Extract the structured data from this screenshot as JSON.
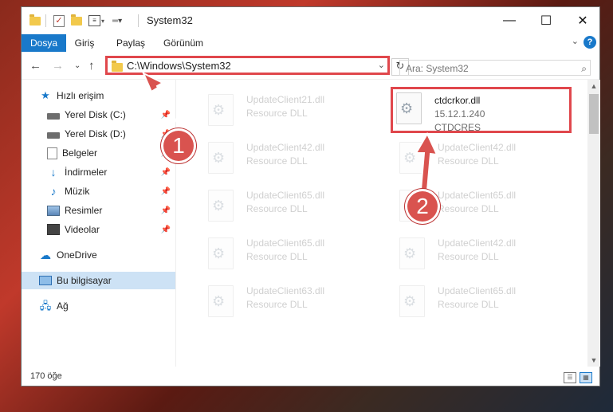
{
  "window": {
    "title": "System32"
  },
  "ribbon": {
    "tabs": [
      {
        "label": "Dosya",
        "active": true
      },
      {
        "label": "Giriş"
      },
      {
        "label": "Paylaş"
      },
      {
        "label": "Görünüm"
      }
    ],
    "help": "?"
  },
  "address": {
    "path": "C:\\Windows\\System32",
    "search_placeholder": "Ara: System32"
  },
  "nav": {
    "items": [
      {
        "label": "Hızlı erişim",
        "icon": "star-icon"
      },
      {
        "label": "Yerel Disk (C:)",
        "icon": "disk-icon"
      },
      {
        "label": "Yerel Disk (D:)",
        "icon": "disk-icon"
      },
      {
        "label": "Belgeler",
        "icon": "documents-icon"
      },
      {
        "label": "İndirmeler",
        "icon": "downloads-icon"
      },
      {
        "label": "Müzik",
        "icon": "music-icon"
      },
      {
        "label": "Resimler",
        "icon": "pictures-icon"
      },
      {
        "label": "Videolar",
        "icon": "videos-icon"
      },
      {
        "label": "OneDrive",
        "icon": "onedrive-icon"
      },
      {
        "label": "Bu bilgisayar",
        "icon": "this-pc-icon",
        "selected": true
      },
      {
        "label": "Ağ",
        "icon": "network-icon"
      }
    ]
  },
  "files": {
    "left_col": [
      {
        "name": "UpdateClient21.dll",
        "desc": "Resource DLL"
      },
      {
        "name": "UpdateClient42.dll",
        "desc": "Resource DLL"
      },
      {
        "name": "UpdateClient65.dll",
        "desc": "Resource DLL"
      },
      {
        "name": "UpdateClient65.dll",
        "desc": "Resource DLL"
      },
      {
        "name": "UpdateClient63.dll",
        "desc": "Resource DLL"
      }
    ],
    "highlighted": {
      "name": "ctdcrkor.dll",
      "version": "15.12.1.240",
      "company": "CTDCRES"
    },
    "right_col": [
      {
        "name": "UpdateClient42.dll",
        "desc": "Resource DLL"
      },
      {
        "name": "UpdateClient65.dll",
        "desc": "Resource DLL"
      },
      {
        "name": "UpdateClient42.dll",
        "desc": "Resource DLL"
      },
      {
        "name": "UpdateClient65.dll",
        "desc": "Resource DLL"
      }
    ]
  },
  "status": {
    "count": "170 öğe"
  },
  "callouts": [
    "1",
    "2"
  ],
  "colors": {
    "accent": "#1979ca",
    "highlight_red": "#e0474c",
    "selected_bg": "#cde2f5"
  }
}
